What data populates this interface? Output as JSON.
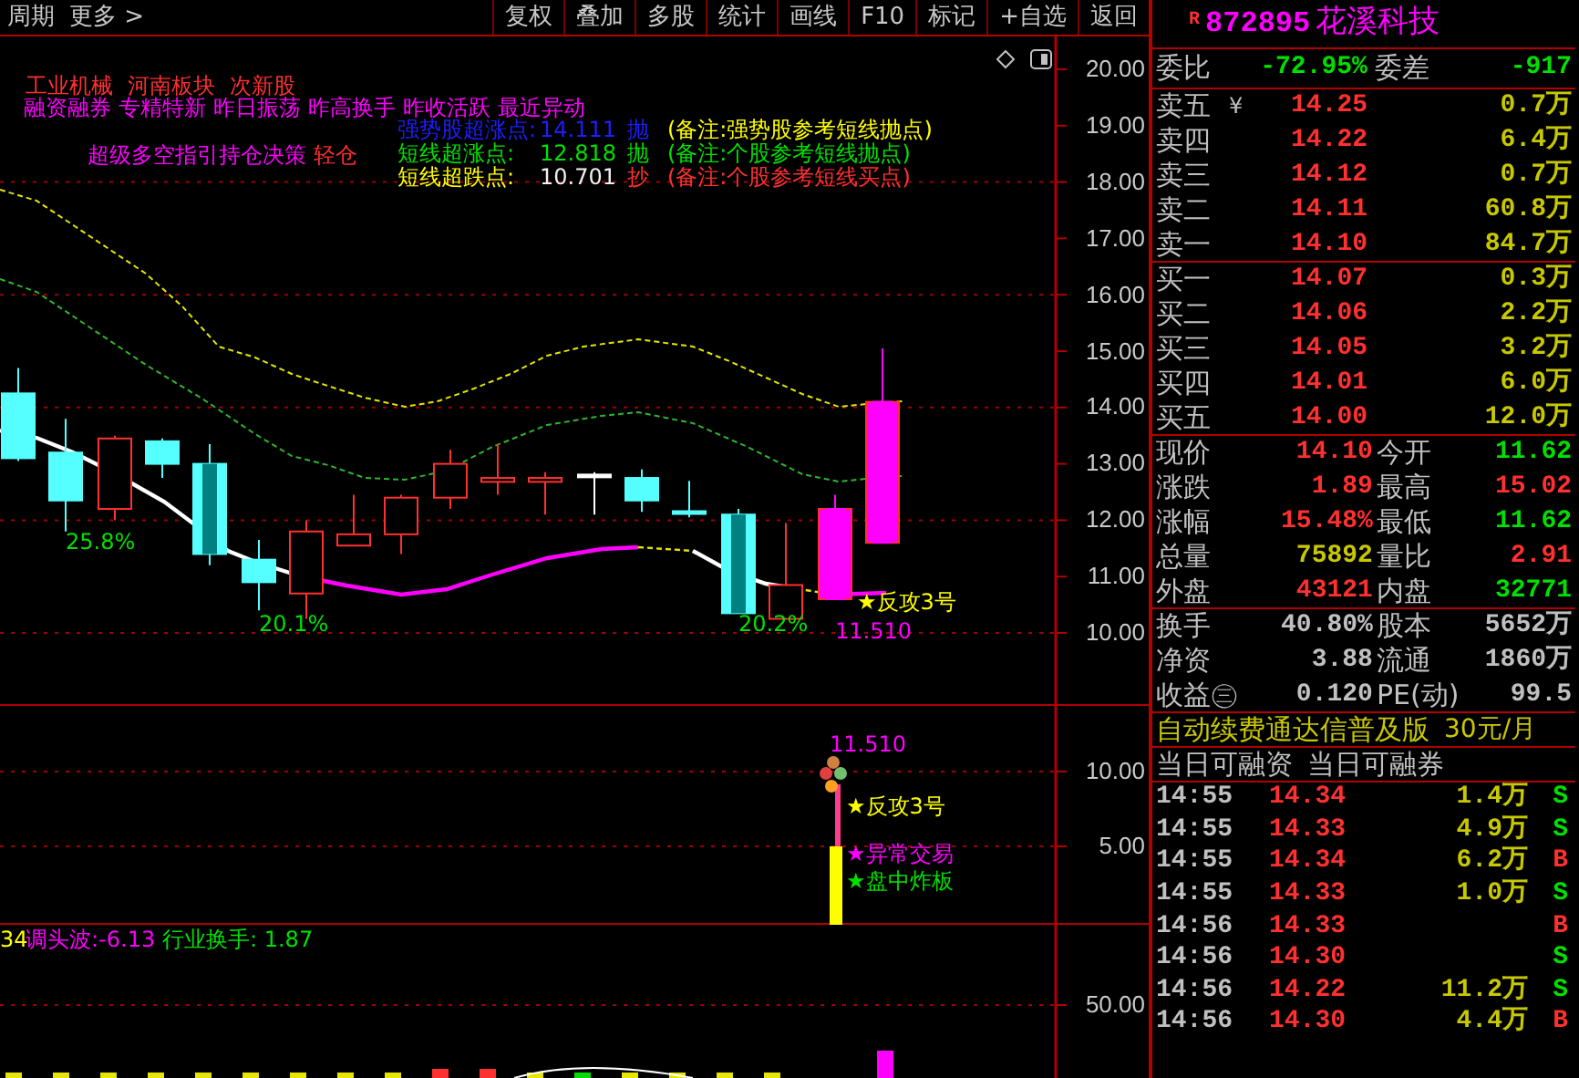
{
  "toolbar": {
    "left": [
      "周期",
      "更多 >"
    ],
    "buttons": [
      "复权",
      "叠加",
      "多股",
      "统计",
      "画线",
      "F10",
      "标记",
      "+自选",
      "返回"
    ]
  },
  "price_chart": {
    "sector_tags": [
      "工业机械",
      "河南板块",
      "次新股"
    ],
    "concept_tags": [
      "融资融券",
      "专精特新",
      "昨日振荡",
      "昨高换手",
      "昨收活跃",
      "最近异动"
    ],
    "signal_lines": [
      {
        "kind": "strong",
        "label": "强势股超涨点:",
        "value": "14.111",
        "action": "抛",
        "note": "(备注:强势股参考短线抛点)"
      },
      {
        "kind": "up",
        "label": "短线超涨点:",
        "value": "12.818",
        "action": "抛",
        "note": "(备注:个股参考短线抛点)"
      },
      {
        "kind": "down",
        "label": "短线超跌点:",
        "value": "10.701",
        "action": "抄",
        "note": "(备注:个股参考短线买点)"
      }
    ],
    "position_advice": {
      "text": "超级多空指引持仓决策",
      "level": "轻仓"
    },
    "bar_labels": [
      "25.8%",
      "20.1%",
      "20.2%"
    ],
    "price_marker": "11.510",
    "signal_marker": "★反攻3号",
    "axis_labels": [
      "20.00",
      "19.00",
      "18.00",
      "17.00",
      "16.00",
      "15.00",
      "14.00",
      "13.00",
      "12.00",
      "11.00",
      "10.00"
    ]
  },
  "signal_pane": {
    "value_label": "11.510",
    "signals": [
      {
        "kind": "counter",
        "text": "★反攻3号"
      },
      {
        "kind": "abnormal",
        "text": "★异常交易"
      },
      {
        "kind": "broken",
        "text": "★盘中炸板"
      }
    ],
    "axis_labels": [
      "10.00",
      "5.00"
    ]
  },
  "indicator_pane": {
    "readouts": [
      {
        "kind": "cut",
        "text": "34"
      },
      {
        "kind": "wave",
        "text": "调头波:-6.13"
      },
      {
        "kind": "turnover",
        "text": "行业换手: 1.87"
      }
    ],
    "axis_labels": [
      "50.00"
    ]
  },
  "quote": {
    "badge": "R",
    "code": "872895",
    "name": "花溪科技",
    "ratio": {
      "label": "委比",
      "value": "-72.95%",
      "label2": "委差",
      "value2": "-917"
    },
    "asks": [
      {
        "label": "卖五",
        "marker": "¥",
        "price": "14.25",
        "volume": "0.7万"
      },
      {
        "label": "卖四",
        "price": "14.22",
        "volume": "6.4万"
      },
      {
        "label": "卖三",
        "price": "14.12",
        "volume": "0.7万"
      },
      {
        "label": "卖二",
        "price": "14.11",
        "volume": "60.8万"
      },
      {
        "label": "卖一",
        "price": "14.10",
        "volume": "84.7万"
      }
    ],
    "bids": [
      {
        "label": "买一",
        "price": "14.07",
        "volume": "0.3万"
      },
      {
        "label": "买二",
        "price": "14.06",
        "volume": "2.2万"
      },
      {
        "label": "买三",
        "price": "14.05",
        "volume": "3.2万"
      },
      {
        "label": "买四",
        "price": "14.01",
        "volume": "6.0万"
      },
      {
        "label": "买五",
        "price": "14.00",
        "volume": "12.0万"
      }
    ],
    "stats": [
      [
        {
          "label": "现价",
          "value": "14.10",
          "kind": "up"
        },
        {
          "label": "今开",
          "value": "11.62",
          "kind": "down"
        }
      ],
      [
        {
          "label": "涨跌",
          "value": "1.89",
          "kind": "up"
        },
        {
          "label": "最高",
          "value": "15.02",
          "kind": "up"
        }
      ],
      [
        {
          "label": "涨幅",
          "value": "15.48%",
          "kind": "up"
        },
        {
          "label": "最低",
          "value": "11.62",
          "kind": "down"
        }
      ],
      [
        {
          "label": "总量",
          "value": "75892",
          "kind": "volume"
        },
        {
          "label": "量比",
          "value": "2.91",
          "kind": "up"
        }
      ],
      [
        {
          "label": "外盘",
          "value": "43121",
          "kind": "up"
        },
        {
          "label": "内盘",
          "value": "32771",
          "kind": "down"
        }
      ]
    ],
    "fundamentals": [
      [
        {
          "label": "换手",
          "value": "40.80%"
        },
        {
          "label": "股本",
          "value": "5652万"
        }
      ],
      [
        {
          "label": "净资",
          "value": "3.88"
        },
        {
          "label": "流通",
          "value": "1860万"
        }
      ],
      [
        {
          "label": "收益㊂",
          "value": "0.120"
        },
        {
          "label": "PE(动)",
          "value": "99.5"
        }
      ]
    ],
    "promo": {
      "text": "自动续费通达信普及版",
      "price": "30元/月"
    },
    "margin": [
      "当日可融资",
      "当日可融券"
    ],
    "ticks": [
      {
        "time": "14:55",
        "price": "14.34",
        "volume": "1.4万",
        "side": "S",
        "kind": "sell"
      },
      {
        "time": "14:55",
        "price": "14.33",
        "volume": "4.9万",
        "side": "S",
        "kind": "sell"
      },
      {
        "time": "14:55",
        "price": "14.34",
        "volume": "6.2万",
        "side": "B",
        "kind": "buy"
      },
      {
        "time": "14:55",
        "price": "14.33",
        "volume": "1.0万",
        "side": "S",
        "kind": "sell"
      },
      {
        "time": "14:56",
        "price": "14.33",
        "side": "B",
        "kind": "buy"
      },
      {
        "time": "14:56",
        "price": "14.30",
        "side": "S",
        "kind": "sell"
      },
      {
        "time": "14:56",
        "price": "14.22",
        "volume": "11.2万",
        "side": "S",
        "kind": "sell"
      },
      {
        "time": "14:56",
        "price": "14.30",
        "volume": "4.4万",
        "side": "B",
        "kind": "buy"
      }
    ]
  }
}
